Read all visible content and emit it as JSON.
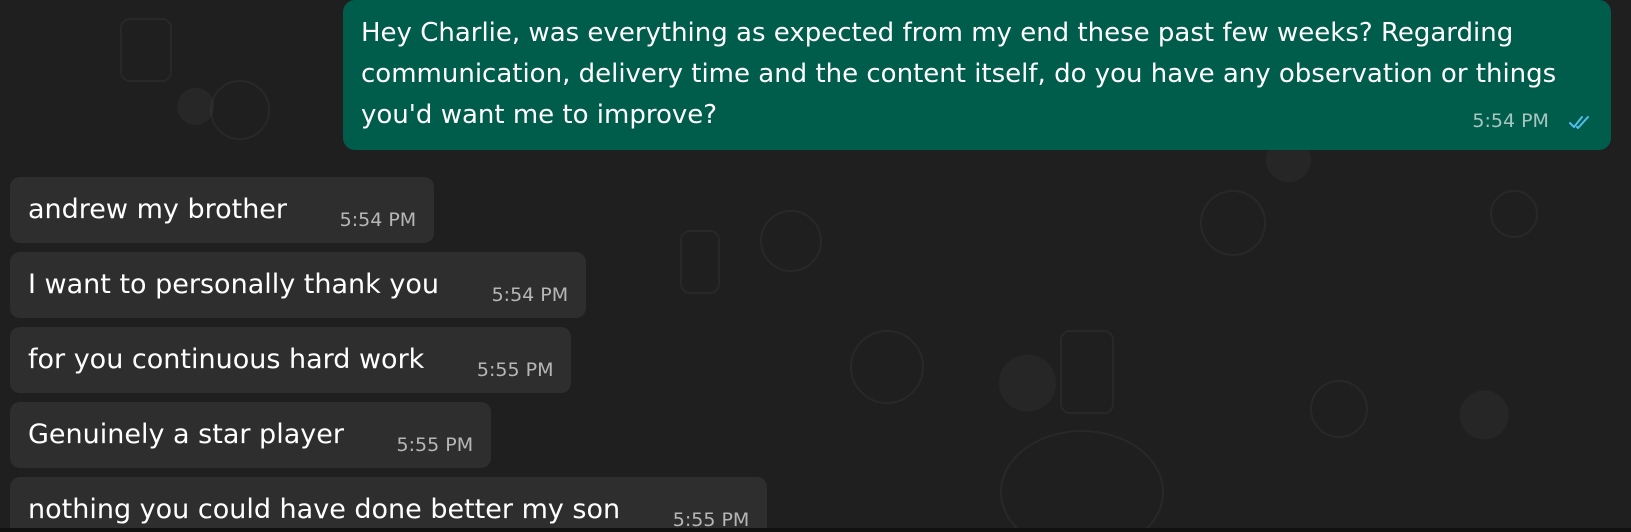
{
  "conversation": {
    "messages": [
      {
        "direction": "outgoing",
        "text": "Hey Charlie, was everything as expected from my end these past few weeks? Regarding communication, delivery time and the content itself, do you have any observation or things you'd want me to improve?",
        "time": "5:54 PM",
        "status_icon": "double-check-icon"
      },
      {
        "direction": "incoming",
        "text": "andrew my brother",
        "time": "5:54 PM"
      },
      {
        "direction": "incoming",
        "text": "I want to personally thank you",
        "time": "5:54 PM"
      },
      {
        "direction": "incoming",
        "text": "for you continuous hard work",
        "time": "5:55 PM"
      },
      {
        "direction": "incoming",
        "text": "Genuinely a star player",
        "time": "5:55 PM"
      },
      {
        "direction": "incoming",
        "text": "nothing you could have done better my son",
        "time": "5:55 PM"
      }
    ]
  },
  "colors": {
    "background": "#1f1f1f",
    "outgoing_bubble": "#005c4b",
    "incoming_bubble": "#2e2e2e",
    "read_receipt": "#53bdeb"
  }
}
